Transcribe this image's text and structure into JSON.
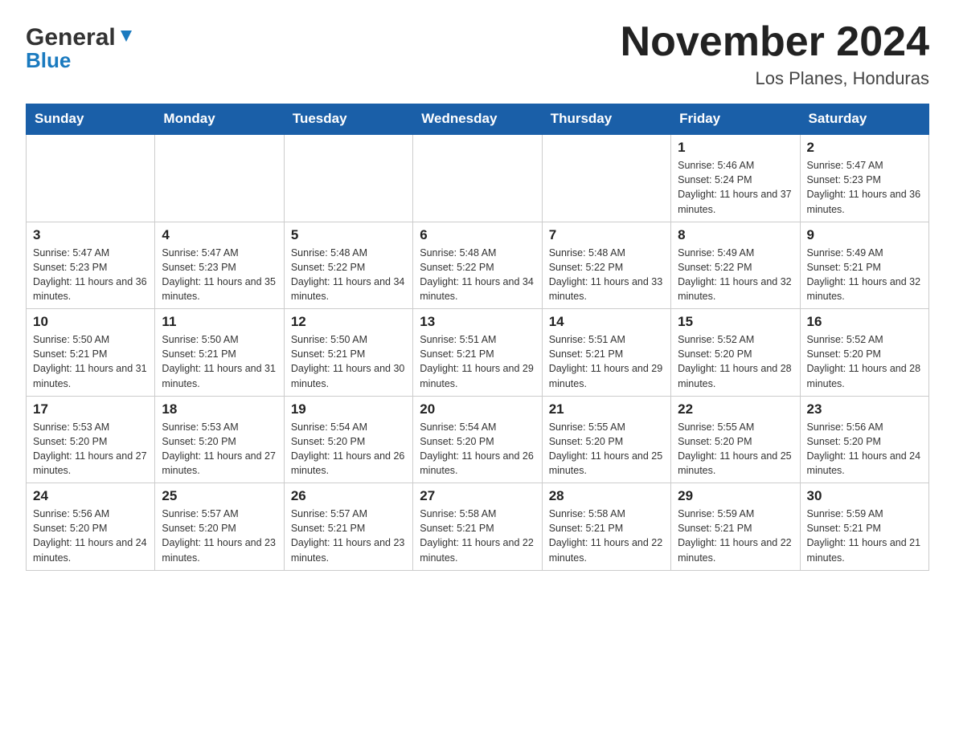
{
  "header": {
    "month_title": "November 2024",
    "location": "Los Planes, Honduras",
    "logo_general": "General",
    "logo_blue": "Blue"
  },
  "weekdays": [
    "Sunday",
    "Monday",
    "Tuesday",
    "Wednesday",
    "Thursday",
    "Friday",
    "Saturday"
  ],
  "weeks": [
    [
      {
        "day": "",
        "empty": true
      },
      {
        "day": "",
        "empty": true
      },
      {
        "day": "",
        "empty": true
      },
      {
        "day": "",
        "empty": true
      },
      {
        "day": "",
        "empty": true
      },
      {
        "day": "1",
        "sunrise": "5:46 AM",
        "sunset": "5:24 PM",
        "daylight": "11 hours and 37 minutes."
      },
      {
        "day": "2",
        "sunrise": "5:47 AM",
        "sunset": "5:23 PM",
        "daylight": "11 hours and 36 minutes."
      }
    ],
    [
      {
        "day": "3",
        "sunrise": "5:47 AM",
        "sunset": "5:23 PM",
        "daylight": "11 hours and 36 minutes."
      },
      {
        "day": "4",
        "sunrise": "5:47 AM",
        "sunset": "5:23 PM",
        "daylight": "11 hours and 35 minutes."
      },
      {
        "day": "5",
        "sunrise": "5:48 AM",
        "sunset": "5:22 PM",
        "daylight": "11 hours and 34 minutes."
      },
      {
        "day": "6",
        "sunrise": "5:48 AM",
        "sunset": "5:22 PM",
        "daylight": "11 hours and 34 minutes."
      },
      {
        "day": "7",
        "sunrise": "5:48 AM",
        "sunset": "5:22 PM",
        "daylight": "11 hours and 33 minutes."
      },
      {
        "day": "8",
        "sunrise": "5:49 AM",
        "sunset": "5:22 PM",
        "daylight": "11 hours and 32 minutes."
      },
      {
        "day": "9",
        "sunrise": "5:49 AM",
        "sunset": "5:21 PM",
        "daylight": "11 hours and 32 minutes."
      }
    ],
    [
      {
        "day": "10",
        "sunrise": "5:50 AM",
        "sunset": "5:21 PM",
        "daylight": "11 hours and 31 minutes."
      },
      {
        "day": "11",
        "sunrise": "5:50 AM",
        "sunset": "5:21 PM",
        "daylight": "11 hours and 31 minutes."
      },
      {
        "day": "12",
        "sunrise": "5:50 AM",
        "sunset": "5:21 PM",
        "daylight": "11 hours and 30 minutes."
      },
      {
        "day": "13",
        "sunrise": "5:51 AM",
        "sunset": "5:21 PM",
        "daylight": "11 hours and 29 minutes."
      },
      {
        "day": "14",
        "sunrise": "5:51 AM",
        "sunset": "5:21 PM",
        "daylight": "11 hours and 29 minutes."
      },
      {
        "day": "15",
        "sunrise": "5:52 AM",
        "sunset": "5:20 PM",
        "daylight": "11 hours and 28 minutes."
      },
      {
        "day": "16",
        "sunrise": "5:52 AM",
        "sunset": "5:20 PM",
        "daylight": "11 hours and 28 minutes."
      }
    ],
    [
      {
        "day": "17",
        "sunrise": "5:53 AM",
        "sunset": "5:20 PM",
        "daylight": "11 hours and 27 minutes."
      },
      {
        "day": "18",
        "sunrise": "5:53 AM",
        "sunset": "5:20 PM",
        "daylight": "11 hours and 27 minutes."
      },
      {
        "day": "19",
        "sunrise": "5:54 AM",
        "sunset": "5:20 PM",
        "daylight": "11 hours and 26 minutes."
      },
      {
        "day": "20",
        "sunrise": "5:54 AM",
        "sunset": "5:20 PM",
        "daylight": "11 hours and 26 minutes."
      },
      {
        "day": "21",
        "sunrise": "5:55 AM",
        "sunset": "5:20 PM",
        "daylight": "11 hours and 25 minutes."
      },
      {
        "day": "22",
        "sunrise": "5:55 AM",
        "sunset": "5:20 PM",
        "daylight": "11 hours and 25 minutes."
      },
      {
        "day": "23",
        "sunrise": "5:56 AM",
        "sunset": "5:20 PM",
        "daylight": "11 hours and 24 minutes."
      }
    ],
    [
      {
        "day": "24",
        "sunrise": "5:56 AM",
        "sunset": "5:20 PM",
        "daylight": "11 hours and 24 minutes."
      },
      {
        "day": "25",
        "sunrise": "5:57 AM",
        "sunset": "5:20 PM",
        "daylight": "11 hours and 23 minutes."
      },
      {
        "day": "26",
        "sunrise": "5:57 AM",
        "sunset": "5:21 PM",
        "daylight": "11 hours and 23 minutes."
      },
      {
        "day": "27",
        "sunrise": "5:58 AM",
        "sunset": "5:21 PM",
        "daylight": "11 hours and 22 minutes."
      },
      {
        "day": "28",
        "sunrise": "5:58 AM",
        "sunset": "5:21 PM",
        "daylight": "11 hours and 22 minutes."
      },
      {
        "day": "29",
        "sunrise": "5:59 AM",
        "sunset": "5:21 PM",
        "daylight": "11 hours and 22 minutes."
      },
      {
        "day": "30",
        "sunrise": "5:59 AM",
        "sunset": "5:21 PM",
        "daylight": "11 hours and 21 minutes."
      }
    ]
  ]
}
